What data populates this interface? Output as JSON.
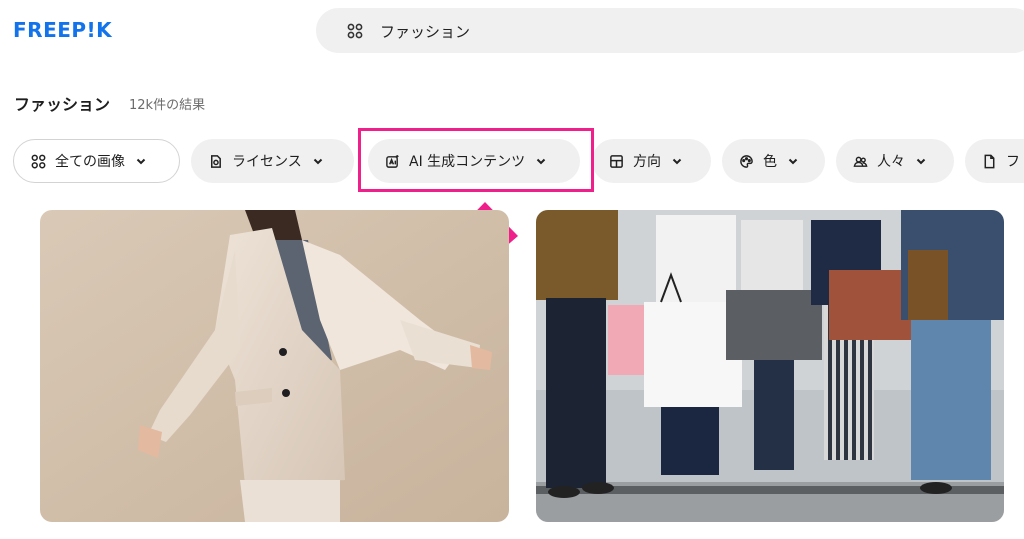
{
  "header": {
    "logo_text": "FREEP!K",
    "search_value": "ファッション",
    "search_icon": "grid-icon"
  },
  "results": {
    "title": "ファッション",
    "count": "12k件の結果"
  },
  "filters": [
    {
      "label": "全ての画像",
      "icon": "grid-icon"
    },
    {
      "label": "ライセンス",
      "icon": "license-icon"
    },
    {
      "label": "AI 生成コンテンツ",
      "icon": "ai-icon"
    },
    {
      "label": "方向",
      "icon": "layout-icon"
    },
    {
      "label": "色",
      "icon": "palette-icon"
    },
    {
      "label": "人々",
      "icon": "people-icon"
    },
    {
      "label": "フ",
      "icon": "file-icon"
    }
  ],
  "annotation": {
    "highlight_color": "#ef1f8c",
    "arrow_direction": "up"
  },
  "colors": {
    "brand": "#1273eb",
    "chip_bg": "#f0f0f0"
  },
  "gallery": [
    {
      "alt": "woman in beige suit photo"
    },
    {
      "alt": "people holding shopping bags photo"
    }
  ]
}
